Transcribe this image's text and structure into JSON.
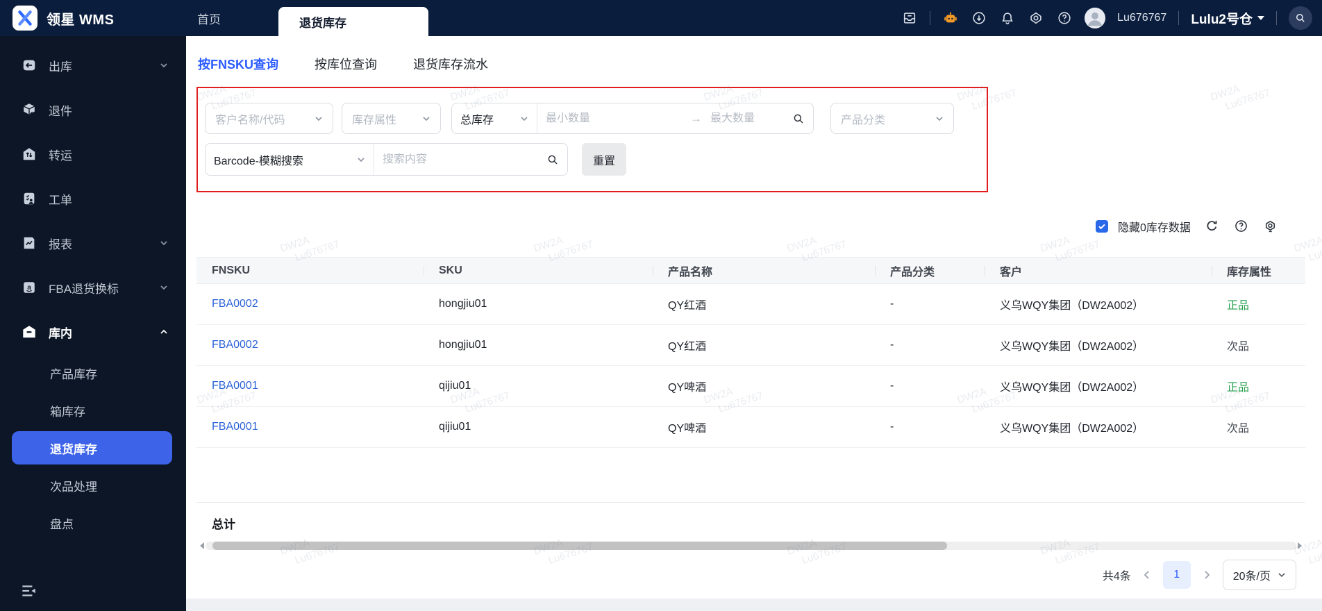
{
  "topbar": {
    "product_name": "领星 WMS",
    "home_label": "首页",
    "window_tab_label": "退货库存",
    "username": "Lu676767",
    "warehouse_selector": "Lulu2号仓"
  },
  "sidebar": {
    "items": [
      {
        "id": "outbound",
        "label": "出库",
        "icon": "outbound-icon",
        "chevron": "down"
      },
      {
        "id": "returns",
        "label": "退件",
        "icon": "returns-icon"
      },
      {
        "id": "transfer",
        "label": "转运",
        "icon": "transfer-icon"
      },
      {
        "id": "work-order",
        "label": "工单",
        "icon": "workorder-icon"
      },
      {
        "id": "reports",
        "label": "报表",
        "icon": "reports-icon",
        "chevron": "down"
      },
      {
        "id": "fba-relabel",
        "label": "FBA退货换标",
        "icon": "fba-relabel-icon",
        "chevron": "down"
      },
      {
        "id": "in-warehouse",
        "label": "库内",
        "icon": "warehouse-icon",
        "chevron": "up",
        "expanded": true,
        "children": [
          {
            "id": "product-inventory",
            "label": "产品库存"
          },
          {
            "id": "box-inventory",
            "label": "箱库存"
          },
          {
            "id": "returns-inventory",
            "label": "退货库存",
            "active": true
          },
          {
            "id": "defective-handling",
            "label": "次品处理"
          },
          {
            "id": "stocktaking",
            "label": "盘点"
          }
        ]
      }
    ]
  },
  "tabs": [
    {
      "id": "by-fnsku",
      "label": "按FNSKU查询",
      "active": true
    },
    {
      "id": "by-location",
      "label": "按库位查询",
      "active": false
    },
    {
      "id": "inventory-flow",
      "label": "退货库存流水",
      "active": false
    }
  ],
  "filters": {
    "customer_placeholder": "客户名称/代码",
    "attribute_placeholder": "库存属性",
    "stock_type_value": "总库存",
    "min_qty_placeholder": "最小数量",
    "max_qty_placeholder": "最大数量",
    "category_placeholder": "产品分类",
    "barcode_mode_value": "Barcode-模糊搜索",
    "search_placeholder": "搜索内容",
    "reset_label": "重置"
  },
  "list_controls": {
    "hide_zero_label": "隐藏0库存数据",
    "hide_zero_checked": true
  },
  "table": {
    "columns": [
      "FNSKU",
      "SKU",
      "产品名称",
      "产品分类",
      "客户",
      "库存属性"
    ],
    "rows": [
      {
        "fnsku": "FBA0002",
        "sku": "hongjiu01",
        "product_name": "QY红酒",
        "category": "-",
        "customer": "义乌WQY集团（DW2A002）",
        "attribute": "正品",
        "attribute_genuine": true
      },
      {
        "fnsku": "FBA0002",
        "sku": "hongjiu01",
        "product_name": "QY红酒",
        "category": "-",
        "customer": "义乌WQY集团（DW2A002）",
        "attribute": "次品",
        "attribute_genuine": false
      },
      {
        "fnsku": "FBA0001",
        "sku": "qijiu01",
        "product_name": "QY啤酒",
        "category": "-",
        "customer": "义乌WQY集团（DW2A002）",
        "attribute": "正品",
        "attribute_genuine": true
      },
      {
        "fnsku": "FBA0001",
        "sku": "qijiu01",
        "product_name": "QY啤酒",
        "category": "-",
        "customer": "义乌WQY集团（DW2A002）",
        "attribute": "次品",
        "attribute_genuine": false
      }
    ],
    "total_label": "总计"
  },
  "pagination": {
    "total_text": "共4条",
    "current_page": "1",
    "page_size_value": "20条/页"
  },
  "watermark": {
    "line1": "DW2A",
    "line2": "Lu676767"
  },
  "colors": {
    "accent_blue": "#2b5bff",
    "sidebar_active_blue": "#3d63e8",
    "genuine_green": "#2aa150",
    "filter_highlight_red": "#e21d1d",
    "checkbox_blue": "#2968e8"
  }
}
